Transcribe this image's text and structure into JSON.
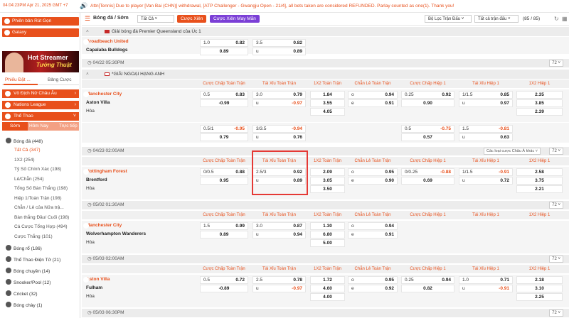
{
  "topbar": {
    "time": "04:04:23PM Apr 21, 2025 GMT +7",
    "marquee": "Attn[Tennis] Due to player [Van Bai (CHN)] withdrawal, [ATP Challenger - Gwangju Open - 21/4], all bets taken are considered REFUNDED. Parlay counted as one(1). Thank you!"
  },
  "sidebar": {
    "btn1": "Phiên bản Rút Gọn",
    "btn2": "Galaxy",
    "banner_t1": "Hot Streamer",
    "banner_t2": "Tướng Thuật",
    "tab_a": "Phiếu Đặt ...",
    "tab_b": "Bảng Cược",
    "sec1": "Vô Địch Nữ Châu Âu",
    "sec2": "Nations League",
    "sec3": "Thể Thao",
    "tt": [
      "Sớm",
      "Hôm Nay",
      "Trực tiếp"
    ],
    "items": [
      {
        "label": "Bóng đá (448)",
        "type": "main"
      },
      {
        "label": "Tất Cả (347)",
        "type": "sub act"
      },
      {
        "label": "1X2 (254)",
        "type": "sub"
      },
      {
        "label": "Tỷ Số Chính Xác (198)",
        "type": "sub"
      },
      {
        "label": "Lẻ/Chẵn (254)",
        "type": "sub"
      },
      {
        "label": "Tổng Số Bàn Thắng (198)",
        "type": "sub"
      },
      {
        "label": "Hiệp 1/Toàn Trận (198)",
        "type": "sub"
      },
      {
        "label": "Chẵn / Lẻ của Nửa trậ...",
        "type": "sub"
      },
      {
        "label": "Bàn thắng Đầu/ Cuối (198)",
        "type": "sub"
      },
      {
        "label": "Cá Cược Tổng Hợp (494)",
        "type": "sub"
      },
      {
        "label": "Cược Thắng (101)",
        "type": "sub"
      },
      {
        "label": "Bóng rổ (186)",
        "type": "main"
      },
      {
        "label": "Thể Thao Điện Tử (21)",
        "type": "main"
      },
      {
        "label": "Bóng chuyền (14)",
        "type": "main"
      },
      {
        "label": "Snooker/Pool (12)",
        "type": "main"
      },
      {
        "label": "Cricket (32)",
        "type": "main"
      },
      {
        "label": "Bóng chày (1)",
        "type": "main"
      }
    ]
  },
  "ctrl": {
    "sport": "Bóng đá / Sớm",
    "filter": "Tất Cả",
    "pill1": "Cược Xiên",
    "pill2": "Cược Xiên May Mắn",
    "sel1": "Bộ Lọc Trận Đấu",
    "sel2": "Tất cả trận đấu",
    "pages": "(85 / 85)"
  },
  "headers": [
    "Cược Chấp Toàn Trận",
    "Tài Xỉu Toàn Trận",
    "1X2 Toàn Trận",
    "Chẵn Lẻ Toàn Trận",
    "Cược Chấp Hiệp 1",
    "Tài Xỉu Hiệp 1",
    "1X2 Hiệp 1"
  ],
  "league1": "Giải bóng đá Premier Queensland của Úc 1",
  "league2": "*GIẢI NGOẠI HẠNG ANH",
  "m0": {
    "home": "Broadbeach United",
    "away": "Capalaba Bulldogs",
    "r1": [
      "1.0",
      "0.82",
      "3.5",
      "0.82"
    ],
    "r2": [
      "0.89",
      "u",
      "0.89"
    ]
  },
  "d1": "04/22 05:30PM",
  "m1": {
    "home": "Manchester City",
    "away": "Aston Villa",
    "draw": "Hòa",
    "r1": [
      "0.5",
      "0.83",
      "3.0",
      "0.79",
      "1.84",
      "o",
      "0.94",
      "0.25",
      "0.92",
      "1/1.5",
      "0.85",
      "2.35"
    ],
    "r2": [
      "-0.99",
      "u",
      "-0.97",
      "3.55",
      "e",
      "0.91",
      "0.90",
      "u",
      "0.97",
      "3.85"
    ],
    "r3": [
      "4.05",
      "2.39"
    ],
    "x1": [
      "0.5/1",
      "-0.95",
      "3/3.5",
      "-0.94",
      "0.5",
      "-0.75",
      "1.5",
      "-0.81"
    ],
    "x2": [
      "0.79",
      "u",
      "0.76",
      "0.57",
      "u",
      "0.63"
    ]
  },
  "d2": "04/23 02:00AM",
  "dd": "Các loại cược Châu Á khác",
  "more": "72",
  "m2": {
    "home": "Nottingham Forest",
    "away": "Brentford",
    "draw": "Hòa",
    "r1": [
      "0/0.5",
      "0.88",
      "2.5/3",
      "0.92",
      "2.09",
      "o",
      "0.95",
      "0/0.25",
      "-0.88",
      "1/1.5",
      "-0.91",
      "2.58"
    ],
    "r2": [
      "0.95",
      "u",
      "0.89",
      "3.05",
      "e",
      "0.90",
      "0.69",
      "u",
      "0.72",
      "3.75"
    ],
    "r3": [
      "3.50",
      "2.21"
    ]
  },
  "d3": "05/02 01:30AM",
  "m3": {
    "home": "Manchester City",
    "away": "Wolverhampton Wanderers",
    "draw": "Hòa",
    "r1": [
      "1.5",
      "0.99",
      "3.0",
      "0.87",
      "1.30",
      "o",
      "0.94"
    ],
    "r2": [
      "0.89",
      "u",
      "0.94",
      "6.80",
      "e",
      "0.91"
    ],
    "r3": [
      "5.00"
    ]
  },
  "d4": "05/03 02:00AM",
  "m4": {
    "home": "Aston Villa",
    "away": "Fulham",
    "draw": "Hòa",
    "r1": [
      "0.5",
      "0.72",
      "2.5",
      "0.78",
      "1.72",
      "o",
      "0.95",
      "0.25",
      "0.94",
      "1.0",
      "0.71",
      "2.18"
    ],
    "r2": [
      "-0.89",
      "u",
      "-0.97",
      "4.60",
      "e",
      "0.92",
      "0.82",
      "u",
      "-0.91",
      "3.10"
    ],
    "r3": [
      "4.00",
      "2.25"
    ]
  },
  "d5": "05/03 06:30PM"
}
